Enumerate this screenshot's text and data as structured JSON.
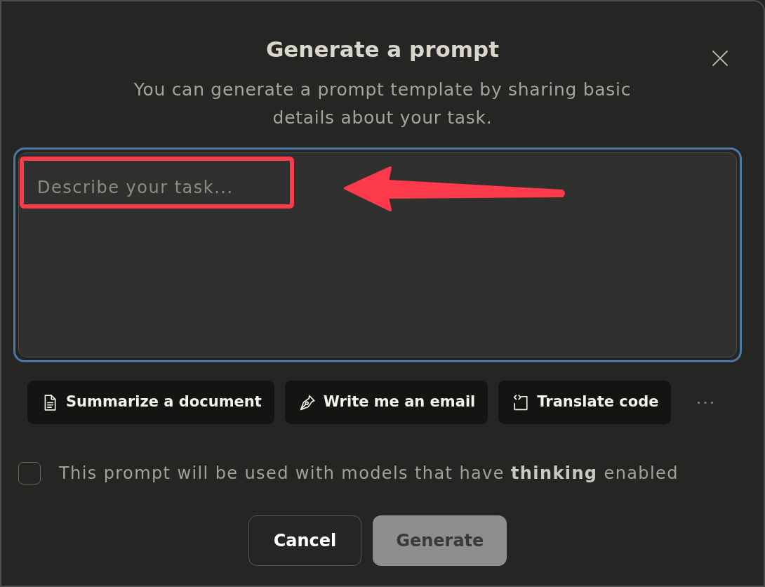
{
  "dialog": {
    "title": "Generate a prompt",
    "subtitle": "You can generate a prompt template by sharing basic details about your task."
  },
  "task_field": {
    "placeholder": "Describe your task...",
    "focused": true
  },
  "suggestions": [
    {
      "label": "Summarize a document",
      "kind": "document"
    },
    {
      "label": "Write me an email",
      "kind": "pen"
    },
    {
      "label": "Translate code",
      "kind": "code"
    }
  ],
  "thinking_checkbox": {
    "label": "This prompt will be used with models that have **thinking** enabled",
    "checked": false
  },
  "buttons": [
    {
      "label": "Cancel",
      "kind": "secondary",
      "disabled": false
    },
    {
      "label": "Generate",
      "kind": "primary",
      "disabled": true
    }
  ],
  "annotation": {
    "highlight_box": true,
    "arrow": true
  }
}
